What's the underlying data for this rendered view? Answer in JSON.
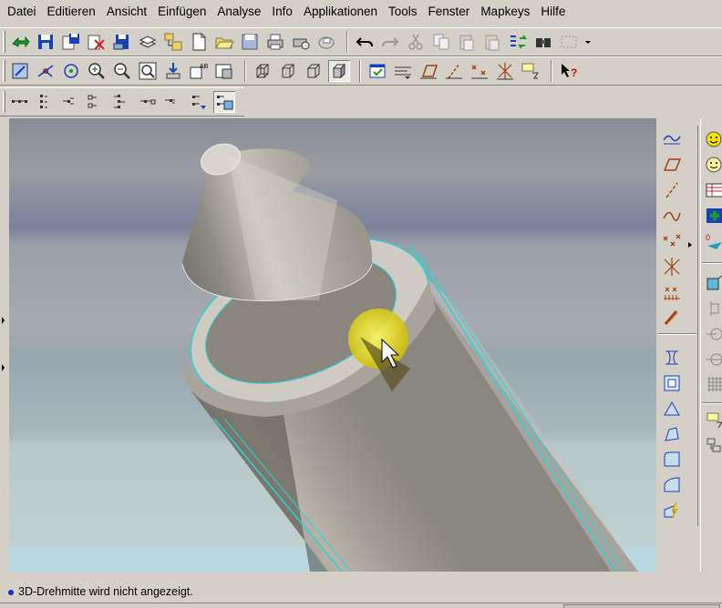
{
  "menubar": {
    "items": [
      "Datei",
      "Editieren",
      "Ansicht",
      "Einfügen",
      "Analyse",
      "Info",
      "Applikationen",
      "Tools",
      "Fenster",
      "Mapkeys",
      "Hilfe"
    ]
  },
  "status": {
    "message": "3D-Drehmitte wird nicht angezeigt."
  },
  "colors": {
    "chrome": "#d4d0c8",
    "highlight_edge": "#22d6d8",
    "spin_center": "#f0e000",
    "status_bullet": "#1030c8"
  },
  "icons": {
    "toolbar1": [
      "window-activate-icon",
      "save-icon",
      "save-copy-icon",
      "backup-icon",
      "rename-icon",
      "layers-icon",
      "model-tree-icon",
      "new-icon",
      "open-icon",
      "save-disk-icon",
      "print-icon",
      "print-setup-icon",
      "email-icon",
      "undo-icon",
      "redo-icon",
      "cut-icon",
      "copy-icon",
      "paste-icon",
      "paste-special-icon",
      "regenerate-icon",
      "find-icon",
      "select-box-icon"
    ],
    "toolbar2": [
      "repaint-icon",
      "spin-center-icon",
      "orient-icon",
      "zoom-in-icon",
      "zoom-out-icon",
      "refit-icon",
      "view-manager-icon",
      "saved-views-icon",
      "named-view-icon",
      "wireframe-icon",
      "hidden-line-icon",
      "no-hidden-icon",
      "shading-icon",
      "datum-plane-display-icon",
      "datum-axis-display-icon",
      "datum-point-display-icon",
      "coord-sys-display-icon",
      "annotation-display-icon",
      "context-help-icon"
    ],
    "toolbar3": [
      "filter-1-icon",
      "filter-2-icon",
      "filter-3-icon",
      "filter-4-icon",
      "filter-5-icon",
      "filter-6-icon",
      "filter-7-icon",
      "filter-8-icon"
    ],
    "datum_tools": [
      "datum-analysis-icon",
      "datum-plane-icon",
      "datum-axis-icon",
      "datum-curve-icon",
      "datum-point-icon",
      "datum-offset-point-icon",
      "datum-sketch-point-icon",
      "datum-coord-icon"
    ],
    "feature_tools": [
      "hole-icon",
      "shell-icon",
      "rib-icon",
      "draft-icon",
      "round-icon",
      "chamfer-icon",
      "cosmetic-icon"
    ],
    "extra_tools": [
      "smiley-icon",
      "smiley-2-icon",
      "table-icon",
      "add-green-icon",
      "relations-icon",
      "extrude-icon",
      "revolve-icon",
      "sweep-icon",
      "blend-icon",
      "pattern-icon",
      "insert-icon",
      "copy-feature-icon"
    ]
  }
}
